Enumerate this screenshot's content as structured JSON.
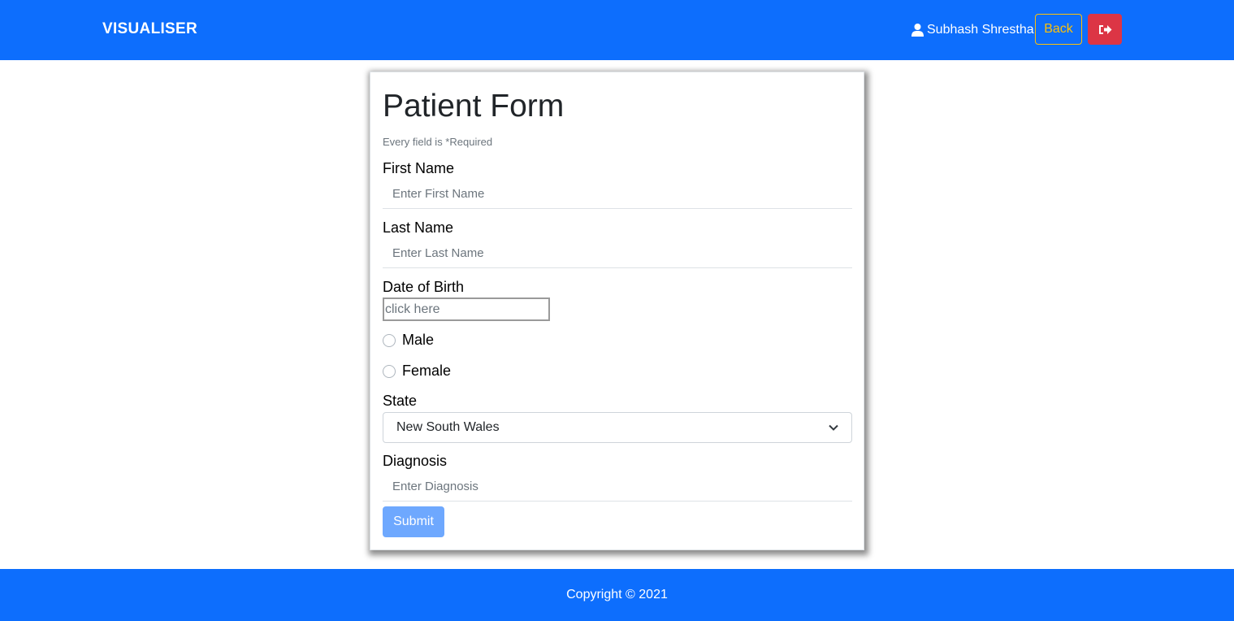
{
  "navbar": {
    "brand": "VISUALISER",
    "user_name": "Subhash Shrestha",
    "back_label": "Back",
    "colors": {
      "bar": "#0d6efd",
      "back": "#ffc107",
      "logout": "#dc3545"
    }
  },
  "form": {
    "title": "Patient Form",
    "note": "Every field is *Required",
    "first_name": {
      "label": "First Name",
      "placeholder": "Enter First Name"
    },
    "last_name": {
      "label": "Last Name",
      "placeholder": "Enter Last Name"
    },
    "dob": {
      "label": "Date of Birth",
      "placeholder": "click here"
    },
    "gender": {
      "options": [
        "Male",
        "Female"
      ]
    },
    "state": {
      "label": "State",
      "selected": "New South Wales"
    },
    "diagnosis": {
      "label": "Diagnosis",
      "placeholder": "Enter Diagnosis"
    },
    "submit_label": "Submit"
  },
  "footer": {
    "text": "Copyright © 2021"
  },
  "icons": {
    "user": "user-icon",
    "logout": "sign-out-icon",
    "select": "chevron-down-icon"
  }
}
